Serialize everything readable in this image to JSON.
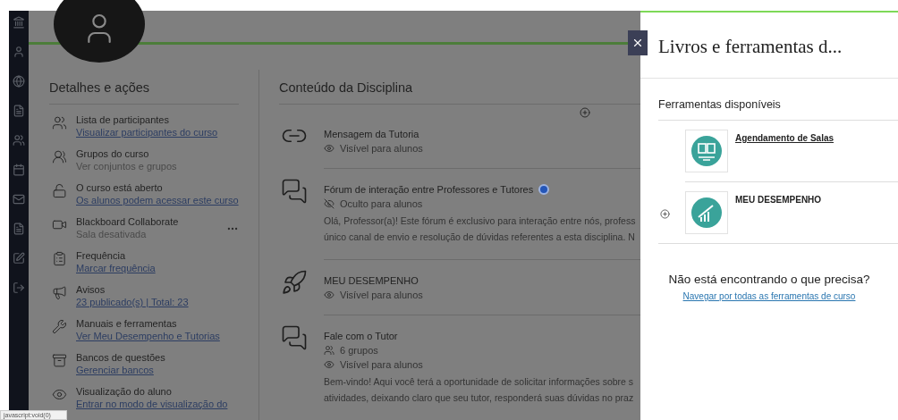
{
  "details": {
    "title": "Detalhes e ações",
    "items": [
      {
        "title": "Lista de participantes",
        "sub": "Visualizar participantes do curso",
        "link": true,
        "menu": false
      },
      {
        "title": "Grupos do curso",
        "sub": "Ver conjuntos e grupos",
        "link": false,
        "menu": false
      },
      {
        "title": "O curso está aberto",
        "sub": "Os alunos podem acessar este curso",
        "link": true,
        "menu": false
      },
      {
        "title": "Blackboard Collaborate",
        "sub": "Sala desativada",
        "link": false,
        "menu": true
      },
      {
        "title": "Frequência",
        "sub": "Marcar frequência",
        "link": true,
        "menu": false
      },
      {
        "title": "Avisos",
        "sub": "23 publicado(s) | Total: 23",
        "link": true,
        "menu": false
      },
      {
        "title": "Manuais e ferramentas",
        "sub": "Ver Meu Desempenho e Tutorias",
        "link": true,
        "menu": false
      },
      {
        "title": "Bancos de questões",
        "sub": "Gerenciar bancos",
        "link": true,
        "menu": false
      },
      {
        "title": "Visualização do aluno",
        "sub": "Entrar no modo de visualização do",
        "link": true,
        "menu": false
      }
    ]
  },
  "content": {
    "title": "Conteúdo da Disciplina",
    "items": [
      {
        "title": "Mensagem da Tutoria",
        "unread": false,
        "meta": [
          {
            "kind": "visible",
            "text": "Visível para alunos"
          }
        ]
      },
      {
        "title": "Fórum de interação entre Professores e Tutores",
        "unread": true,
        "meta": [
          {
            "kind": "hidden",
            "text": "Oculto para alunos"
          }
        ],
        "description": [
          "Olá, Professor(a)! Este fórum é exclusivo para interação entre nós, profess",
          "único canal de envio e resolução de dúvidas referentes a esta disciplina. N"
        ]
      },
      {
        "title": "MEU DESEMPENHO",
        "unread": false,
        "meta": [
          {
            "kind": "visible",
            "text": "Visível para alunos"
          }
        ]
      },
      {
        "title": "Fale com o Tutor",
        "unread": false,
        "meta": [
          {
            "kind": "groups",
            "text": "6 grupos"
          },
          {
            "kind": "visible",
            "text": "Visível para alunos"
          }
        ],
        "description": [
          "Bem-vindo! Aqui você terá a oportunidade de solicitar informações sobre s",
          "atividades, deixando claro que seu tutor, responderá suas dúvidas no praz"
        ]
      }
    ]
  },
  "panel": {
    "title": "Livros e ferramentas d...",
    "section": "Ferramentas disponíveis",
    "tools": [
      {
        "name": "Agendamento de Salas",
        "link": true,
        "add": false
      },
      {
        "name": "MEU DESEMPENHO",
        "link": false,
        "add": true
      }
    ],
    "help": "Não está encontrando o que precisa?",
    "help_link": "Navegar por todas as ferramentas de curso"
  },
  "status_bar": "javascript:void(0)"
}
